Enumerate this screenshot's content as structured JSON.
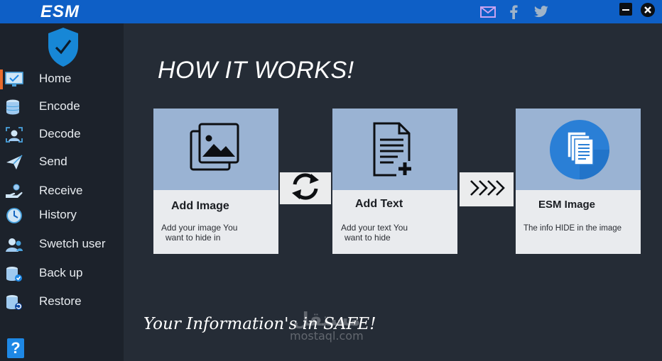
{
  "app": {
    "title": "ESM"
  },
  "titlebar": {
    "icons": [
      "mail-icon",
      "facebook-icon",
      "twitter-icon"
    ],
    "colors": {
      "bar": "#0e5fc6",
      "mail": "#c9a3f0"
    }
  },
  "sidebar": {
    "items": [
      {
        "label": "Home",
        "icon": "monitor-icon"
      },
      {
        "label": "Encode",
        "icon": "database-icon"
      },
      {
        "label": "Decode",
        "icon": "face-scan-icon"
      },
      {
        "label": "Send",
        "icon": "paper-plane-icon"
      },
      {
        "label": "Receive",
        "icon": "hand-coin-icon"
      },
      {
        "label": "History",
        "icon": "clock-icon"
      },
      {
        "label": "Swetch user",
        "icon": "users-icon"
      },
      {
        "label": "Back up",
        "icon": "database-check-icon"
      },
      {
        "label": "Restore",
        "icon": "database-restore-icon"
      }
    ],
    "active": "Home",
    "help_label": "?"
  },
  "main": {
    "heading": "HOW IT WORKS!",
    "cards": [
      {
        "title": "Add Image",
        "desc": [
          "Add your image You",
          "want to hide in"
        ],
        "icon": "image-gallery-icon"
      },
      {
        "title": "Add Text",
        "desc": [
          "Add your text You",
          "want to hide"
        ],
        "icon": "document-add-icon"
      },
      {
        "title": "ESM Image",
        "desc": [
          "The info HIDE in the image"
        ],
        "icon": "documents-circle-icon"
      }
    ],
    "tagline": "Your Information's in SAFE!"
  },
  "watermark": {
    "arabic": "مستقل",
    "latin": "mostaql.com"
  }
}
